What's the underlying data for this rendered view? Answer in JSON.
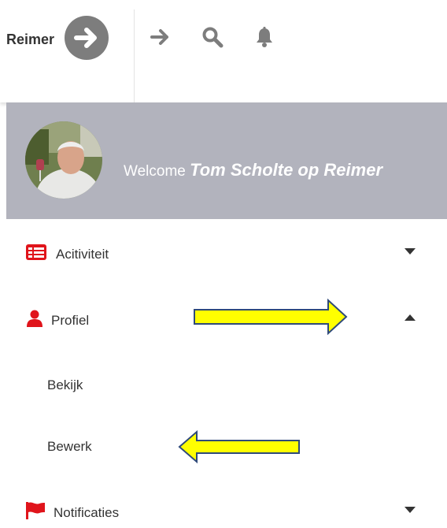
{
  "header": {
    "brand": "Reimer",
    "icons": [
      "arrow-circle-right-icon",
      "arrow-right-icon",
      "search-icon",
      "bell-icon"
    ]
  },
  "welcome": {
    "greeting": "Welcome",
    "user_name": "Tom Scholte op Reimer"
  },
  "menu": {
    "activiteit": {
      "label": "Acitiviteit",
      "icon": "list-alt-icon",
      "state": "collapsed"
    },
    "profiel": {
      "label": "Profiel",
      "icon": "user-icon",
      "state": "expanded",
      "children": [
        {
          "label": "Bekijk"
        },
        {
          "label": "Bewerk"
        }
      ]
    },
    "notificaties": {
      "label": "Notificaties",
      "icon": "flag-icon",
      "state": "collapsed"
    }
  },
  "colors": {
    "accent_red": "#e0141b",
    "welcome_band": "#b2b3bd",
    "icon_gray": "#7d7d7d",
    "callout_fill": "#ffff00",
    "callout_stroke": "#2f4a7a"
  }
}
